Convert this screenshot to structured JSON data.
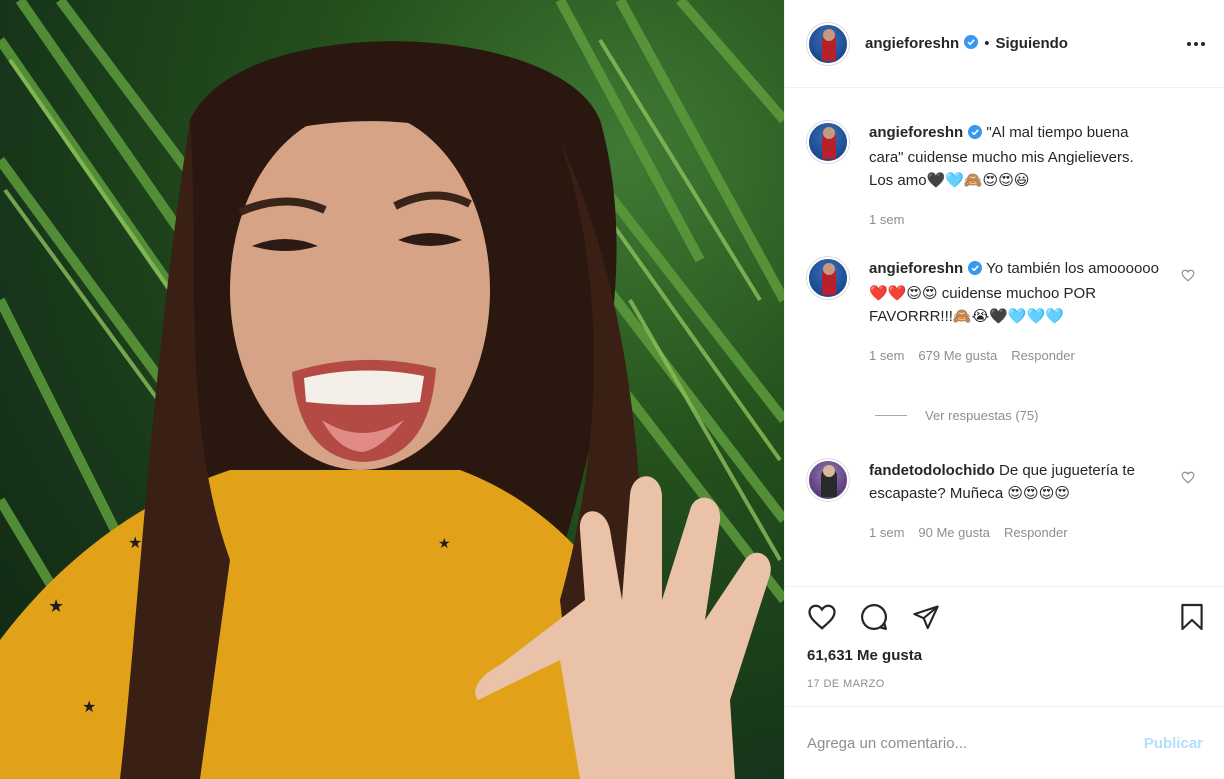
{
  "post": {
    "username": "angieforeshn",
    "header_separator": "•",
    "follow_status": "Siguiendo",
    "caption": {
      "username": "angieforeshn",
      "text": "\"Al mal tiempo buena cara\" cuidense mucho mis Angielievers. Los amo🖤🩵🙈😍😍😃",
      "time": "1 sem"
    },
    "comments": [
      {
        "username": "angieforeshn",
        "text": "Yo también los amoooooo❤️❤️😍😍 cuidense muchoo POR FAVORRR!!!🙈😭🖤🩵🩵🩵",
        "time": "1 sem",
        "likes": "679 Me gusta",
        "reply": "Responder"
      },
      {
        "username": "fandetodolochido",
        "text": "De que juguetería te escapaste? Muñeca 😍😍😍😍",
        "time": "1 sem",
        "likes": "90 Me gusta",
        "reply": "Responder"
      }
    ],
    "view_replies": "Ver respuestas (75)",
    "likes_count": "61,631 Me gusta",
    "date": "17 DE MARZO",
    "comment_placeholder": "Agrega un comentario...",
    "publish_label": "Publicar",
    "icons": {
      "like": "heart-icon",
      "comment": "comment-icon",
      "share": "send-icon",
      "save": "bookmark-icon",
      "more": "more-icon",
      "verified": "verified-badge-icon"
    }
  }
}
